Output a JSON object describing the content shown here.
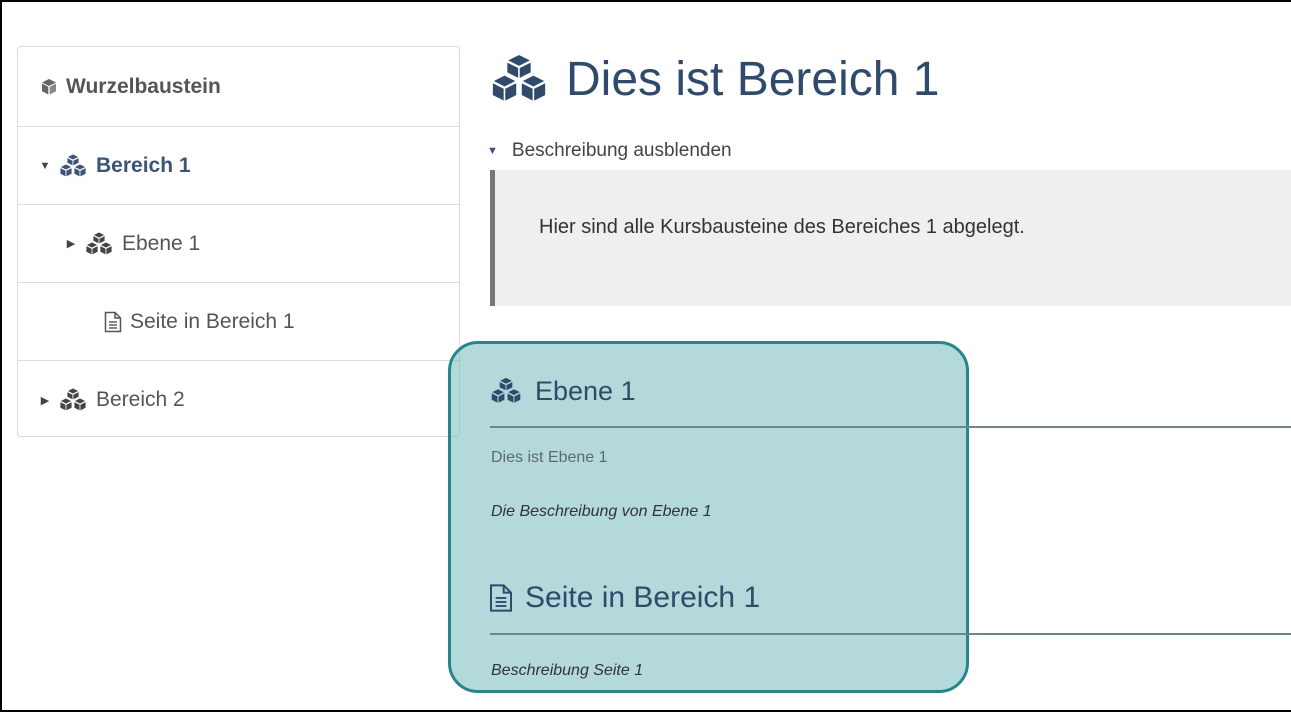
{
  "sidebar": {
    "items": [
      {
        "label": "Wurzelbaustein",
        "icon": "cube-icon"
      },
      {
        "label": "Bereich 1",
        "icon": "cubes-icon",
        "expanded": true
      },
      {
        "label": "Ebene 1",
        "icon": "cubes-icon",
        "expanded": false
      },
      {
        "label": "Seite in Bereich 1",
        "icon": "page-icon"
      },
      {
        "label": "Bereich 2",
        "icon": "cubes-icon",
        "expanded": false
      }
    ]
  },
  "main": {
    "title": "Dies ist Bereich 1",
    "toggle_label": "Beschreibung ausblenden",
    "description": "Hier sind alle Kursbausteine des Bereiches 1 abgelegt.",
    "children": [
      {
        "title": "Ebene 1",
        "subtitle": "Dies ist Ebene 1",
        "description": "Die Beschreibung von Ebene 1"
      },
      {
        "title": "Seite in Bereich 1",
        "description": "Beschreibung Seite 1"
      }
    ]
  },
  "colors": {
    "accent": "#2f4a6a",
    "highlight_border": "#26878a",
    "highlight_fill": "#b4dadb"
  }
}
